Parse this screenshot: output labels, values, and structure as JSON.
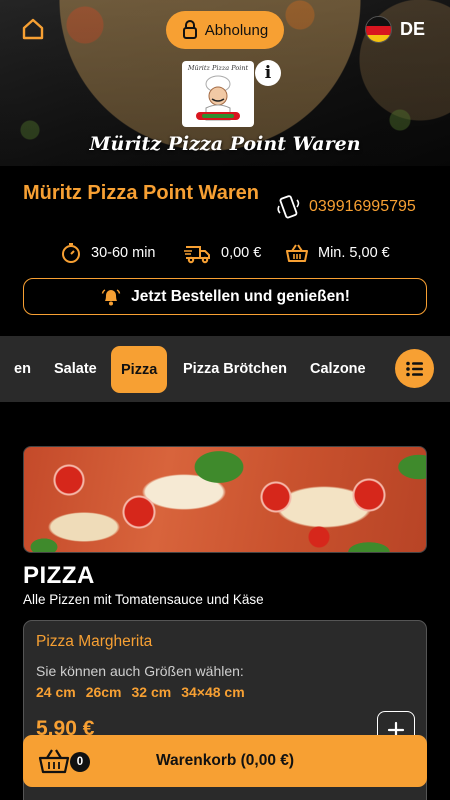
{
  "header": {
    "home_icon": "home-icon",
    "pickup_label": "Abholung",
    "pickup_icon": "lock-icon",
    "language_code": "DE",
    "flag_icon": "germany-flag-icon",
    "logo_text": "Müritz Pizza Point",
    "info_icon": "info-icon",
    "title": "Müritz Pizza Point Waren"
  },
  "restaurant": {
    "name": "Müritz Pizza Point Waren",
    "phone": "039916995795",
    "phone_icon": "phone-ringing-icon",
    "delivery_time": "30-60 min",
    "delivery_fee": "0,00 €",
    "min_order": "Min. 5,00 €",
    "order_cta": "Jetzt Bestellen und genießen!"
  },
  "categories": {
    "items": [
      "en",
      "Salate",
      "Pizza",
      "Pizza Brötchen",
      "Calzone"
    ],
    "active": "Pizza",
    "menu_icon": "list-icon"
  },
  "section": {
    "title": "PIZZA",
    "description": "Alle Pizzen mit Tomatensauce und Käse"
  },
  "product": {
    "name": "Pizza Margherita",
    "size_hint": "Sie können auch Größen wählen:",
    "sizes": [
      "24 cm",
      "26cm",
      "32 cm",
      "34×48 cm"
    ],
    "price": "5,90 €",
    "add_icon": "plus-icon"
  },
  "cart": {
    "label": "Warenkorb (0,00 €)",
    "count": "0",
    "icon": "basket-icon"
  },
  "colors": {
    "accent": "#f7a033",
    "background": "#000000",
    "nav_background": "#2a2a2a"
  }
}
